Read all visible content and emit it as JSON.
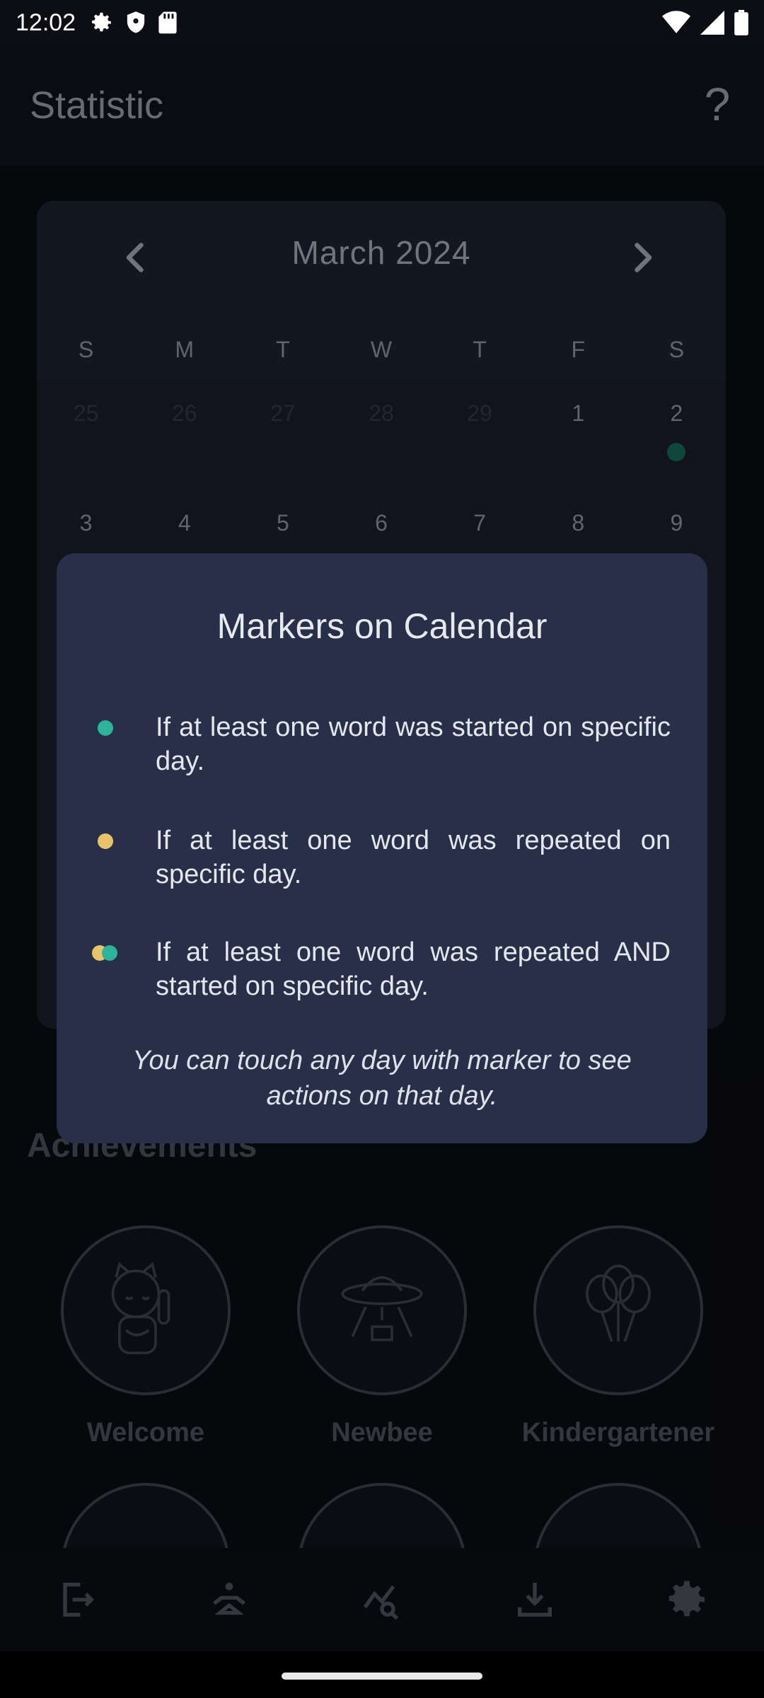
{
  "status_bar": {
    "time": "12:02"
  },
  "header": {
    "title": "Statistic",
    "help_icon": "help-icon"
  },
  "calendar": {
    "month_label": "March  2024",
    "weekdays": [
      "S",
      "M",
      "T",
      "W",
      "T",
      "F",
      "S"
    ],
    "weeks": [
      [
        "25",
        "26",
        "27",
        "28",
        "29",
        "1",
        "2"
      ],
      [
        "3",
        "4",
        "5",
        "6",
        "7",
        "8",
        "9"
      ]
    ],
    "marker_color": "#1a7a66"
  },
  "achievements": {
    "title": "Achievements",
    "items": [
      {
        "label": "Welcome",
        "icon": "lucky-cat-icon"
      },
      {
        "label": "Newbee",
        "icon": "ufo-icon"
      },
      {
        "label": "Kindergartener",
        "icon": "balloons-icon"
      }
    ]
  },
  "bottom_nav": {
    "items": [
      "logout-icon",
      "meditation-icon",
      "statistics-icon",
      "download-icon",
      "settings-icon"
    ]
  },
  "dialog": {
    "title": "Markers on Calendar",
    "items": [
      {
        "marker": "green",
        "text": "If at least one word was started on specific day."
      },
      {
        "marker": "yellow",
        "text": "If at least one word was repeated on specific day."
      },
      {
        "marker": "yellow-green",
        "text": "If at least one word was repeated AND started on specific day."
      }
    ],
    "note": "You can touch any day with marker to see actions on that day.",
    "colors": {
      "green": "#2db49a",
      "yellow": "#e9c36a",
      "background": "#283049"
    }
  }
}
